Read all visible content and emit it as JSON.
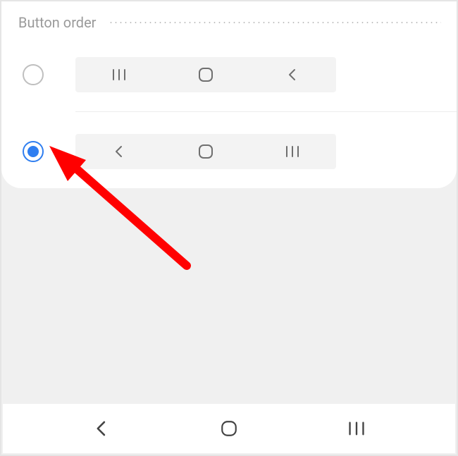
{
  "section": {
    "title": "Button order"
  },
  "options": {
    "order_a": {
      "selected": false,
      "left": "recents",
      "center": "home",
      "right": "back"
    },
    "order_b": {
      "selected": true,
      "left": "back",
      "center": "home",
      "right": "recents"
    }
  },
  "system_navbar": {
    "left": "back",
    "center": "home",
    "right": "recents"
  },
  "icons": {
    "back": "back-icon",
    "home": "home-icon",
    "recents": "recents-icon"
  },
  "colors": {
    "accent": "#2f7ef0",
    "arrow": "#ff0000"
  }
}
